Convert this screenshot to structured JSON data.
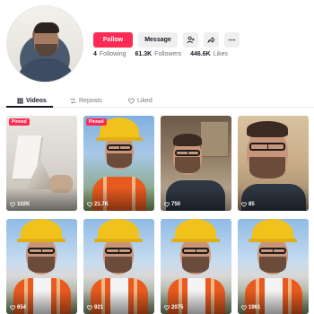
{
  "profile": {
    "buttons": {
      "follow": "Follow",
      "message": "Message"
    },
    "stats": [
      {
        "value": "4",
        "label": "Following"
      },
      {
        "value": "61.3K",
        "label": "Followers"
      },
      {
        "value": "446.6K",
        "label": "Likes"
      }
    ],
    "icons": [
      "add-friend-icon",
      "share-icon",
      "more-icon"
    ]
  },
  "tabs": [
    {
      "label": "Videos",
      "icon": "grid-icon",
      "active": true
    },
    {
      "label": "Reposts",
      "icon": "repost-icon",
      "active": false
    },
    {
      "label": "Liked",
      "icon": "heart-outline-icon",
      "active": false
    }
  ],
  "videos": [
    {
      "views": "102K",
      "pinned": true,
      "pinned_label": "Pinned",
      "scene": "model"
    },
    {
      "views": "21.7K",
      "pinned": true,
      "pinned_label": "Pinned",
      "scene": "hardhat"
    },
    {
      "views": "750",
      "pinned": false,
      "scene": "kitchen"
    },
    {
      "views": "85",
      "pinned": false,
      "scene": "closeup"
    },
    {
      "views": "654",
      "pinned": false,
      "scene": "hardhat"
    },
    {
      "views": "921",
      "pinned": false,
      "scene": "hardhat"
    },
    {
      "views": "2075",
      "pinned": false,
      "scene": "hardhat"
    },
    {
      "views": "1961",
      "pinned": false,
      "scene": "hardhat"
    }
  ],
  "colors": {
    "accent": "#fe2c55",
    "text": "#161823",
    "muted": "#6f7079"
  }
}
